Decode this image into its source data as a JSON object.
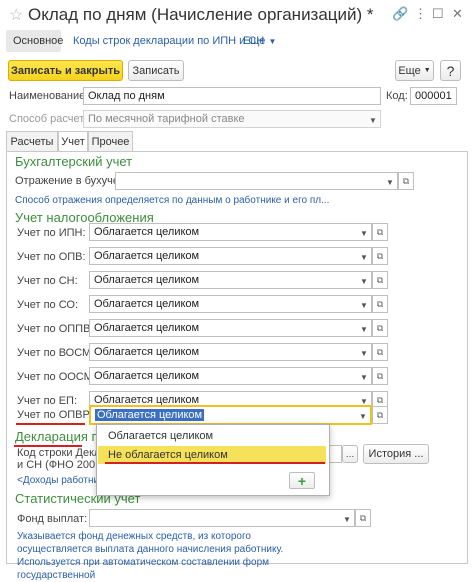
{
  "window": {
    "title": "Оклад по дням (Начисление организаций) *",
    "icons": [
      "star-icon",
      "link-icon",
      "more-icon",
      "maximize-icon",
      "close-icon"
    ]
  },
  "nav": {
    "main_tab": "Основное",
    "link_tab": "Коды строк декларации по ИПН и СН",
    "more_link": "Еще"
  },
  "toolbar": {
    "save_close": "Записать и закрыть",
    "save": "Записать",
    "more": "Еще"
  },
  "header": {
    "name_label": "Наименование:",
    "name_value": "Оклад по дням",
    "code_label": "Код:",
    "code_value": "000001",
    "calc_method_label": "Способ расчета:",
    "calc_method_value": "По месячной тарифной ставке"
  },
  "tabs": [
    "Расчеты",
    "Учет",
    "Прочее"
  ],
  "accounting": {
    "section_title": "Бухгалтерский учет",
    "reflection_label": "Отражение в бухучете:",
    "reflection_value": "",
    "hint": "Способ отражения определяется по данным о работнике и его пл..."
  },
  "tax": {
    "section_title": "Учет налогообложения",
    "rows": [
      {
        "label": "Учет по ИПН:",
        "value": "Облагается целиком"
      },
      {
        "label": "Учет по ОПВ:",
        "value": "Облагается целиком"
      },
      {
        "label": "Учет по СН:",
        "value": "Облагается целиком"
      },
      {
        "label": "Учет по СО:",
        "value": "Облагается целиком"
      },
      {
        "label": "Учет по ОППВ:",
        "value": "Облагается целиком"
      },
      {
        "label": "Учет по ВОСМС:",
        "value": "Облагается целиком"
      },
      {
        "label": "Учет по ООСМС:",
        "value": "Облагается целиком"
      },
      {
        "label": "Учет по ЕП:",
        "value": "Облагается целиком"
      }
    ],
    "opvr_label": "Учет по ОПВР:",
    "opvr_value": "Облагается целиком"
  },
  "declaration": {
    "section_title": "Декларация по",
    "code_label_1": "Код строки Деклар",
    "code_label_2": "и СН (ФНО 200.00",
    "history_button": "История ...",
    "income_link": "<Доходы работник"
  },
  "dropdown": {
    "options": [
      "Облагается целиком",
      "Не облагается целиком"
    ],
    "highlighted_index": 1,
    "add_button": "+"
  },
  "stats": {
    "section_title": "Статистический учет",
    "fund_label": "Фонд выплат:",
    "fund_value": "",
    "note": "Указывается фонд денежных средств, из которого осуществляется выплата данного начисления работнику. Используется при автоматическом составлении форм государственной"
  },
  "colors": {
    "accent_green": "#3d8f3d",
    "link_blue": "#2a5fa8",
    "primary_yellow": "#f5d21c",
    "highlight_yellow": "#f6e25a",
    "annotation_red": "#d42020"
  }
}
